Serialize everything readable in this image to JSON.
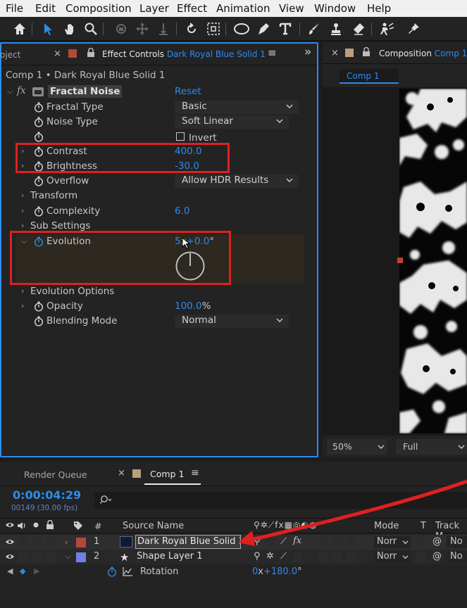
{
  "menu": [
    "File",
    "Edit",
    "Composition",
    "Layer",
    "Effect",
    "Animation",
    "View",
    "Window",
    "Help"
  ],
  "toolbar_icons": [
    "home-icon",
    "selection-arrow-icon",
    "hand-icon",
    "zoom-icon",
    "orbit-camera-icon",
    "pan-camera-icon",
    "dolly-camera-icon",
    "rotate-icon",
    "pan-behind-icon",
    "ellipse-icon",
    "pen-icon",
    "text-icon",
    "brush-icon",
    "clone-stamp-icon",
    "eraser-icon",
    "roto-brush-icon",
    "puppet-pin-icon"
  ],
  "ec_panel": {
    "project_tab_partial": "oject",
    "tab_prefix": "Effect Controls",
    "tab_layer": "Dark Royal Blue Solid 1",
    "breadcrumb": "Comp 1 • Dark Royal Blue Solid 1",
    "effect_name": "Fractal Noise",
    "reset_label": "Reset",
    "props": {
      "fractal_type": {
        "label": "Fractal Type",
        "value": "Basic"
      },
      "noise_type": {
        "label": "Noise Type",
        "value": "Soft Linear"
      },
      "invert": {
        "label": "Invert"
      },
      "contrast": {
        "label": "Contrast",
        "value": "400.0"
      },
      "brightness": {
        "label": "Brightness",
        "value": "-30.0"
      },
      "overflow": {
        "label": "Overflow",
        "value": "Allow HDR Results"
      },
      "transform": {
        "label": "Transform"
      },
      "complexity": {
        "label": "Complexity",
        "value": "6.0"
      },
      "sub_settings": {
        "label": "Sub Settings"
      },
      "evolution": {
        "label": "Evolution",
        "value_rev": "5",
        "value_sep": "x",
        "value_deg": "+0.0",
        "unit": "°"
      },
      "evolution_options": {
        "label": "Evolution Options"
      },
      "opacity": {
        "label": "Opacity",
        "value": "100.0",
        "unit": "%"
      },
      "blending_mode": {
        "label": "Blending Mode",
        "value": "Normal"
      }
    }
  },
  "comp_panel": {
    "tab_prefix": "Composition",
    "tab_comp": "Comp 1",
    "subtab": "Comp 1",
    "zoom": "50%",
    "resolution": "Full"
  },
  "timeline": {
    "render_queue_tab": "Render Queue",
    "comp_tab": "Comp 1",
    "timecode": "0:00:04:29",
    "frames": "00149 (30.00 fps)",
    "search_placeholder": "",
    "col_hash": "#",
    "col_source_name": "Source Name",
    "col_mode": "Mode",
    "col_t": "T",
    "col_track_matte": "Track M",
    "layers": [
      {
        "num": "1",
        "name": "Dark Royal Blue Solid 1",
        "mode": "Norr",
        "matte": "No",
        "label_color": "#b5473c"
      },
      {
        "num": "2",
        "name": "Shape Layer 1",
        "mode": "Norr",
        "matte": "No",
        "label_color": "#6f7ee8"
      }
    ],
    "rotation": {
      "label": "Rotation",
      "rev": "0",
      "sep": "x",
      "deg": "+180.0",
      "unit": "°"
    }
  },
  "colors": {
    "accent": "#2d8ceb",
    "highlight": "#e02020",
    "panel_bg": "#232323"
  }
}
